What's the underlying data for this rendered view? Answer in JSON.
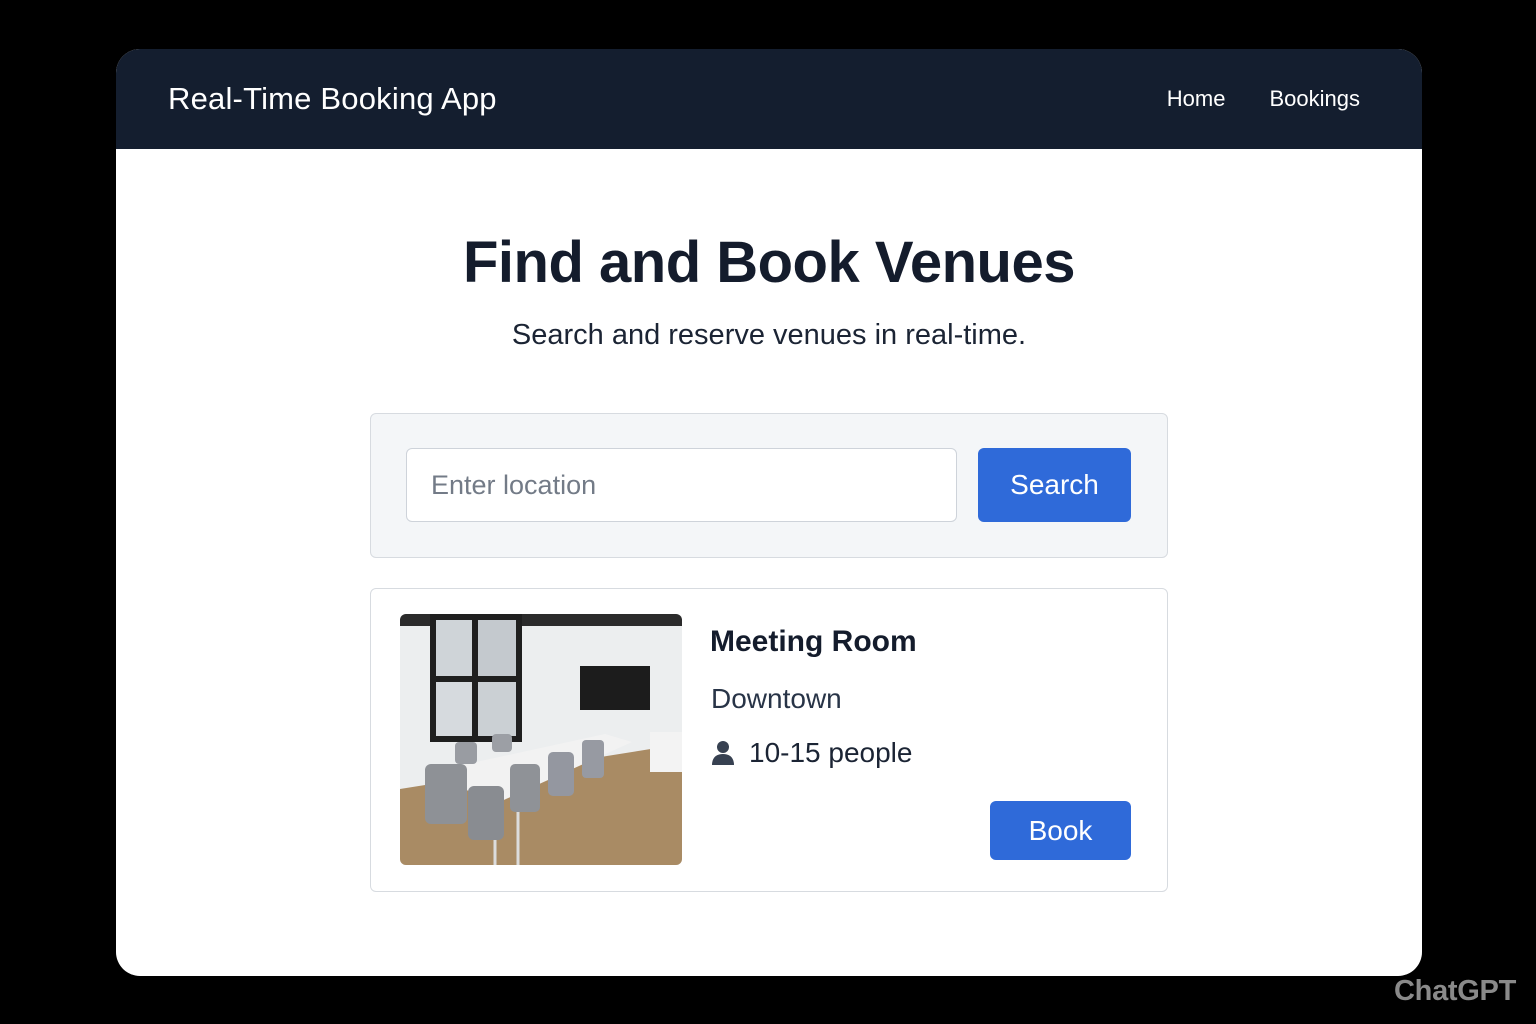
{
  "header": {
    "app_title": "Real-Time Booking App",
    "nav": [
      {
        "label": "Home"
      },
      {
        "label": "Bookings"
      }
    ]
  },
  "hero": {
    "title": "Find and Book Venues",
    "subtitle": "Search and reserve venues in real-time."
  },
  "search": {
    "value": "",
    "placeholder": "Enter location",
    "button_label": "Search"
  },
  "results": [
    {
      "name": "Meeting Room",
      "location": "Downtown",
      "capacity": "10-15 people",
      "capacity_icon": "person-icon",
      "image_icon": "meeting-room-photo",
      "button_label": "Book"
    }
  ],
  "colors": {
    "navbar": "#141e2f",
    "primary": "#2f6ad9",
    "panel": "#f4f6f8",
    "page_background": "#000000"
  },
  "watermark": "ChatGPT"
}
